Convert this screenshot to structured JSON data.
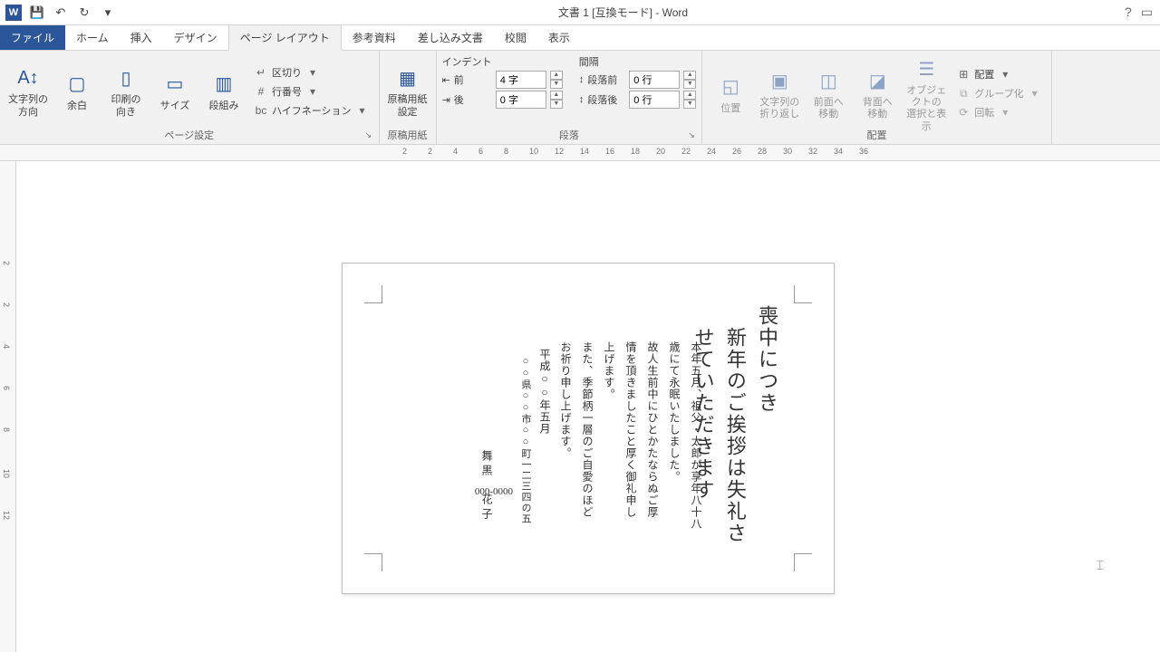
{
  "titlebar": {
    "title": "文書 1 [互換モード] - Word"
  },
  "tabs": {
    "file": "ファイル",
    "home": "ホーム",
    "insert": "挿入",
    "design": "デザイン",
    "layout": "ページ レイアウト",
    "references": "参考資料",
    "mailings": "差し込み文書",
    "review": "校閲",
    "view": "表示"
  },
  "ribbon": {
    "page_setup": {
      "label": "ページ設定",
      "text_direction": "文字列の\n方向",
      "margins": "余白",
      "orientation": "印刷の\n向き",
      "size": "サイズ",
      "columns": "段組み",
      "breaks": "区切り",
      "line_numbers": "行番号",
      "hyphenation": "ハイフネーション"
    },
    "manuscript": {
      "label": "原稿用紙",
      "btn": "原稿用紙\n設定"
    },
    "paragraph": {
      "label": "段落",
      "indent_header": "インデント",
      "spacing_header": "間隔",
      "left_label": "前",
      "right_label": "後",
      "before_label": "段落前",
      "after_label": "段落後",
      "left_value": "4 字",
      "right_value": "0 字",
      "before_value": "0 行",
      "after_value": "0 行"
    },
    "arrange": {
      "label": "配置",
      "position": "位置",
      "wrap": "文字列の\n折り返し",
      "bring_forward": "前面へ\n移動",
      "send_backward": "背面へ\n移動",
      "selection_pane": "オブジェクトの\n選択と表示",
      "align": "配置",
      "group": "グループ化",
      "rotate": "回転"
    }
  },
  "ruler": {
    "h": [
      "2",
      "2",
      "4",
      "6",
      "8",
      "10",
      "12",
      "14",
      "16",
      "18",
      "20",
      "22",
      "24",
      "26",
      "28",
      "30",
      "32",
      "34",
      "36"
    ],
    "v": [
      "2",
      "2",
      "4",
      "6",
      "8",
      "10",
      "12"
    ]
  },
  "document": {
    "heading": "喪中につき\n　新年のご挨拶は失礼さ\n　せていただきます",
    "body": "本年五月、祖父・太郎が享年八十八\n歳にて永眠いたしました。\n故人生前中にひとかたならぬご厚\n情を頂きましたこと厚く御礼申し\n上げます。\nまた、季節柄一層のご自愛のほど\nお祈り申し上げます。",
    "date": "平成○○年五月",
    "address": "○○県○○市○○町一二三四の五",
    "postal": "000-0000",
    "name": "舞黒　花子"
  }
}
